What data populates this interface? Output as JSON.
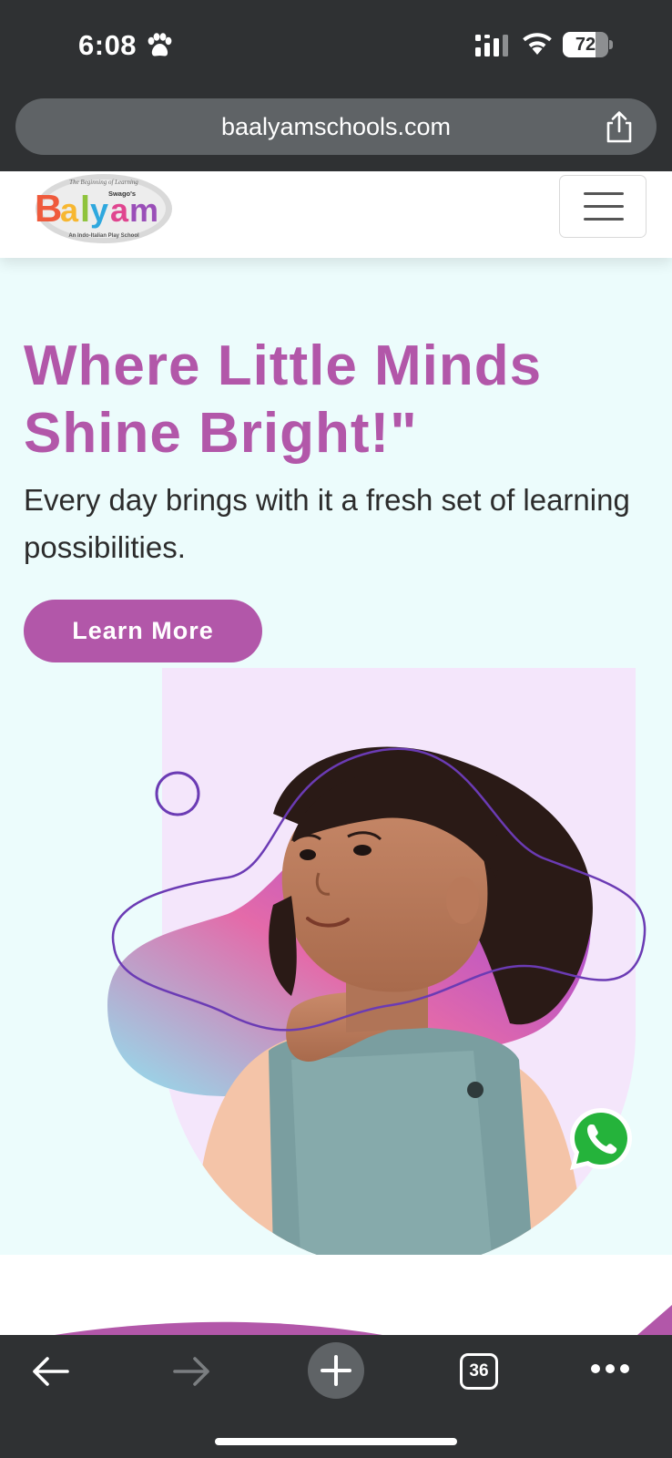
{
  "status_bar": {
    "time": "6:08",
    "battery": "72",
    "battery_level": 0.72,
    "icons": [
      "paw-icon",
      "cellular-signal-icon",
      "wifi-icon",
      "battery-icon"
    ]
  },
  "browser": {
    "url": "baalyamschools.com",
    "share_icon": "share-icon",
    "toolbar": {
      "back_icon": "back-arrow-icon",
      "forward_icon": "forward-arrow-icon",
      "new_tab_icon": "plus-icon",
      "tab_count": "36",
      "more_icon": "more-icon"
    }
  },
  "site": {
    "logo": {
      "tagline": "The Beginning of Learning",
      "brand_prefix": "Swago's",
      "name": "Balyam",
      "subtitle": "An Indo-Italian Play School"
    },
    "menu_icon": "hamburger-menu-icon",
    "hero": {
      "title": "Where Little Minds Shine Bright!\"",
      "subtitle": "Every day brings with it a fresh set of learning possibilities.",
      "cta_label": "Learn More"
    },
    "whatsapp_icon": "whatsapp-icon"
  },
  "colors": {
    "brand_purple": "#b257a9",
    "hero_background": "#ecfcfc",
    "browser_chrome": "#2f3133",
    "whatsapp_green": "#25d366"
  }
}
